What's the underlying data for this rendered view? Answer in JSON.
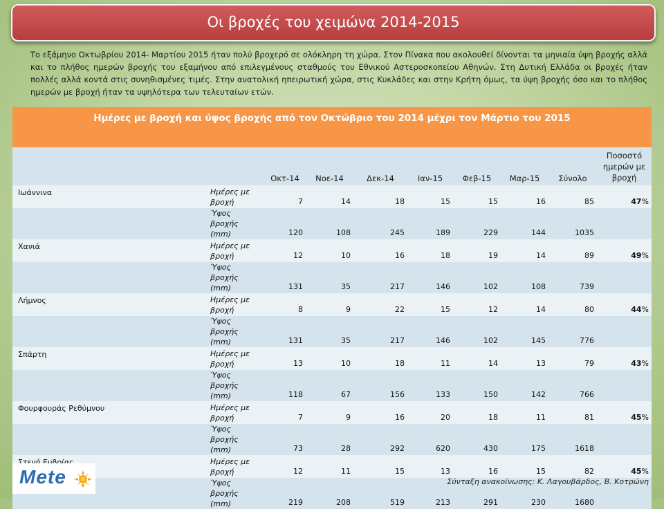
{
  "title": "Οι βροχές του χειμώνα 2014-2015",
  "intro": "Το εξάμηνο Οκτωβρίου 2014- Μαρτίου 2015 ήταν πολύ βροχερό σε ολόκληρη τη χώρα. Στον Πίνακα που ακολουθεί δίνονται τα μηνιαία ύψη βροχής αλλά και το πλήθος ημερών βροχής του εξαμήνου από επιλεγμένους σταθμούς του Εθνικού Αστεροσκοπείου Αθηνών. Στη Δυτική Ελλάδα οι βροχές ήταν πολλές αλλά κοντά στις συνηθισμένες τιμές. Στην ανατολική ηπειρωτική χώρα, στις Κυκλάδες και στην  Κρήτη όμως, τα ύψη βροχής όσο και το πλήθος ημερών με βροχή ήταν τα υψηλότερα των τελευταίων ετών.",
  "table": {
    "title": "Ημέρες με βροχή και ύψος βροχής από τον Οκτώβριο του 2014 μέχρι τον Μάρτιο του 2015",
    "headers": [
      "Οκτ-14",
      "Νοε-14",
      "Δεκ-14",
      "Ιαν-15",
      "Φεβ-15",
      "Μαρ-15",
      "Σύνολο"
    ],
    "pct_header": "Ποσοστό ημερών με βροχή",
    "days_label": "Ημέρες με βροχή",
    "height_label": "Ύψος βροχής (mm)",
    "rows": [
      {
        "city": "Ιωάννινα",
        "days": [
          "7",
          "14",
          "18",
          "15",
          "15",
          "16",
          "85"
        ],
        "height": [
          "120",
          "108",
          "245",
          "189",
          "229",
          "144",
          "1035"
        ],
        "pct": "47",
        "pct_sign": "%"
      },
      {
        "city": "Χανιά",
        "days": [
          "12",
          "10",
          "16",
          "18",
          "19",
          "14",
          "89"
        ],
        "height": [
          "131",
          "35",
          "217",
          "146",
          "102",
          "108",
          "739"
        ],
        "pct": "49",
        "pct_sign": "%"
      },
      {
        "city": "Λήμνος",
        "days": [
          "8",
          "9",
          "22",
          "15",
          "12",
          "14",
          "80"
        ],
        "height": [
          "131",
          "35",
          "217",
          "146",
          "102",
          "145",
          "776"
        ],
        "pct": "44",
        "pct_sign": "%"
      },
      {
        "city": "Σπάρτη",
        "days": [
          "13",
          "10",
          "18",
          "11",
          "14",
          "13",
          "79"
        ],
        "height": [
          "118",
          "67",
          "156",
          "133",
          "150",
          "142",
          "766"
        ],
        "pct": "43",
        "pct_sign": "%"
      },
      {
        "city": "Φουρφουράς Ρεθύμνου",
        "days": [
          "7",
          "9",
          "16",
          "20",
          "18",
          "11",
          "81"
        ],
        "height": [
          "73",
          "28",
          "292",
          "620",
          "430",
          "175",
          "1618"
        ],
        "pct": "45",
        "pct_sign": "%"
      },
      {
        "city": "Στενή Ευβοίας",
        "days": [
          "12",
          "11",
          "15",
          "13",
          "16",
          "15",
          "82"
        ],
        "height": [
          "219",
          "208",
          "519",
          "213",
          "291",
          "230",
          "1680"
        ],
        "pct": "45",
        "pct_sign": "%"
      }
    ]
  },
  "logo": {
    "text": "Mete",
    "icon": "sun-icon"
  },
  "footer": "Σύνταξη ανακοίνωσης: Κ. Λαγουβάρδος, Β. Κοτρώνη",
  "colors": {
    "banner": "#c0504d",
    "table_header": "#f79646",
    "row_light": "#eaf2f6",
    "row_dark": "#d5e3ec",
    "logo_text": "#2a6cb3",
    "logo_sun": "#f2a51a"
  }
}
